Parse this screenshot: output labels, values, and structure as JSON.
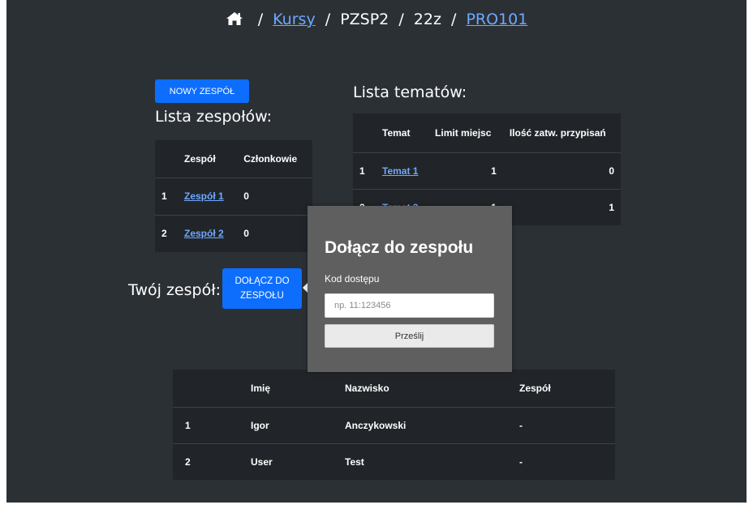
{
  "breadcrumb": {
    "home_icon": "home-icon",
    "separator": "/",
    "courses_link": "Kursy",
    "course_code": "PZSP2",
    "semester": "22z",
    "project_link": "PRO101"
  },
  "teams": {
    "new_team_button": "NOWY ZESPÓŁ",
    "heading": "Lista zespołów:",
    "columns": [
      "",
      "Zespół",
      "Członkowie"
    ],
    "rows": [
      {
        "index": "1",
        "name": "Zespół 1",
        "members": "0"
      },
      {
        "index": "2",
        "name": "Zespół 2",
        "members": "0"
      }
    ]
  },
  "your_team": {
    "label": "Twój zespół:",
    "join_button_line1": "DOŁĄCZ DO",
    "join_button_line2": "ZESPOŁU"
  },
  "topics": {
    "heading": "Lista tematów:",
    "columns": [
      "",
      "Temat",
      "Limit miejsc",
      "Ilość zatw. przypisań"
    ],
    "rows": [
      {
        "index": "1",
        "name": "Temat 1",
        "limit": "1",
        "approved": "0"
      },
      {
        "index": "2",
        "name": "Temat 2",
        "limit": "1",
        "approved": "1"
      }
    ]
  },
  "students": {
    "columns": [
      "",
      "Imię",
      "Nazwisko",
      "Zespół"
    ],
    "rows": [
      {
        "index": "1",
        "first_name": "Igor",
        "last_name": "Anczykowski",
        "team": "-"
      },
      {
        "index": "2",
        "first_name": "User",
        "last_name": "Test",
        "team": "-"
      }
    ]
  },
  "join_modal": {
    "title": "Dołącz do zespołu",
    "code_label": "Kod dostępu",
    "code_placeholder": "np. 11:123456",
    "submit_label": "Prześlij"
  },
  "colors": {
    "page_background": "#2b3035",
    "table_background": "#212529",
    "primary_button": "#0d6efd",
    "link": "#6ea8fe",
    "modal_background": "#5f5f5f"
  }
}
